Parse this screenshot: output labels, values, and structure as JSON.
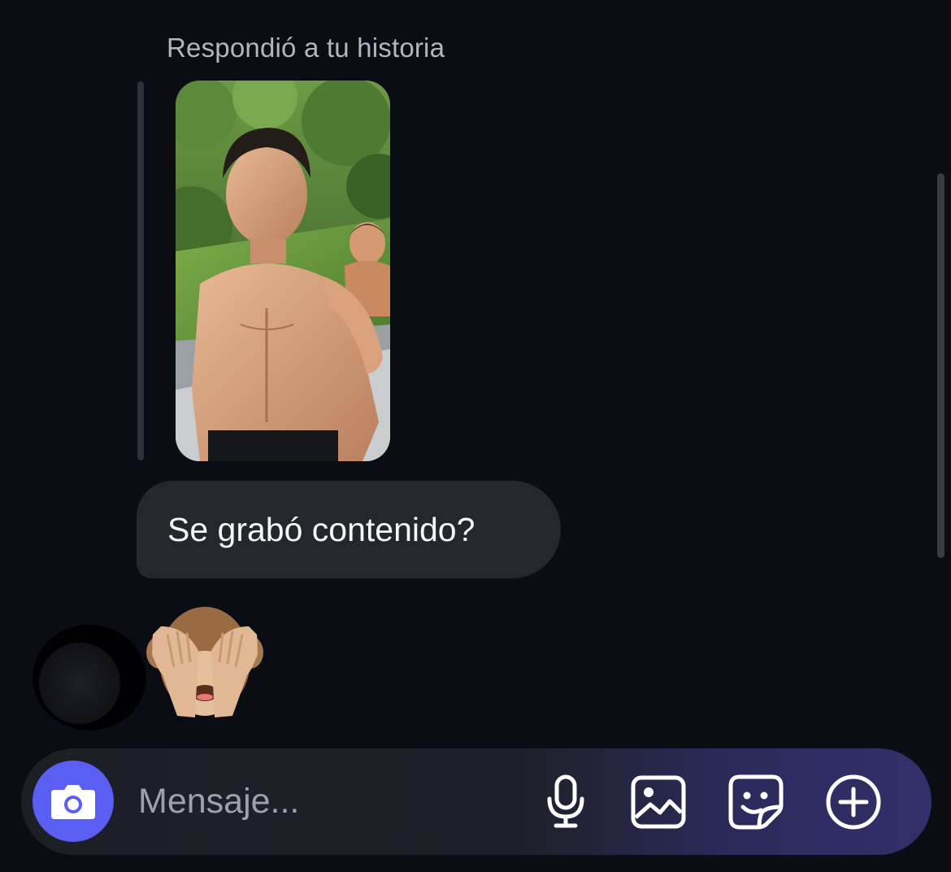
{
  "thread": {
    "reply_caption": "Respondió a tu historia",
    "story": {
      "image_icon": "story-photo"
    },
    "message": "Se grabó contenido?",
    "reaction_emoji": "🙈",
    "avatar_icon": "user-avatar"
  },
  "composer": {
    "placeholder": "Mensaje...",
    "value": "",
    "camera_icon": "camera-icon",
    "actions": [
      {
        "name": "microphone",
        "icon": "microphone-icon"
      },
      {
        "name": "gallery",
        "icon": "image-icon"
      },
      {
        "name": "sticker",
        "icon": "sticker-icon"
      },
      {
        "name": "more",
        "icon": "plus-circle-icon"
      }
    ]
  },
  "colors": {
    "background": "#0b0d14",
    "bubble": "#25272d",
    "accent": "#5b5ef2",
    "caption": "#b3b6bd"
  }
}
